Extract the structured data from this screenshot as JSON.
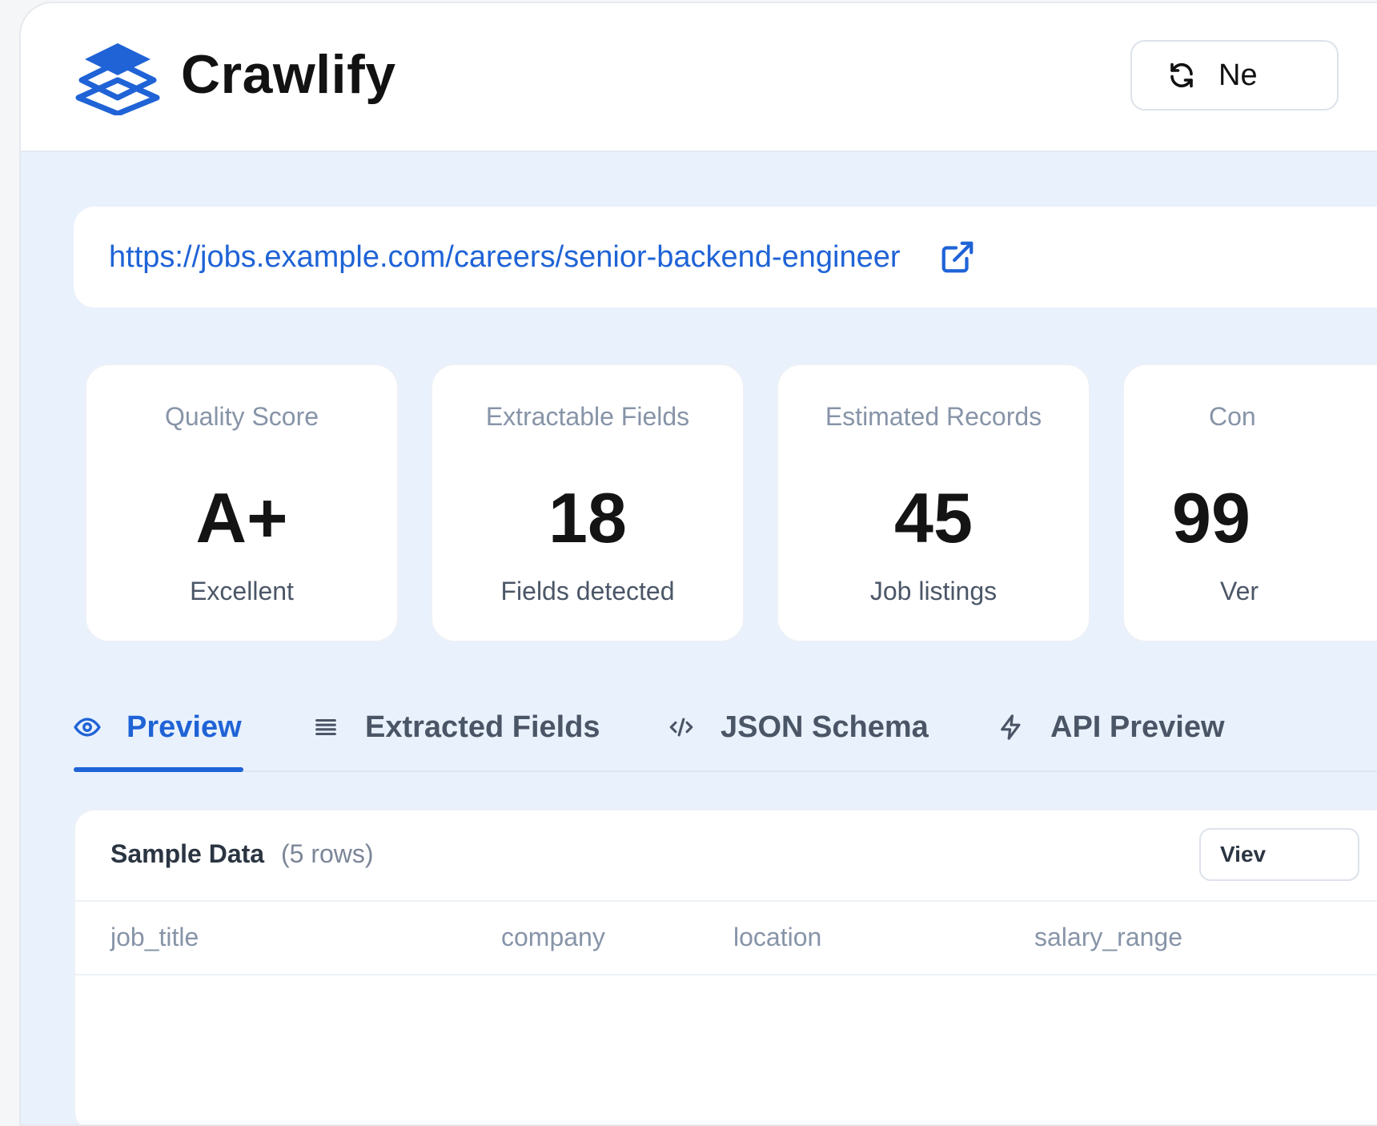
{
  "header": {
    "brand": "Crawlify",
    "new_button_label": "Ne",
    "colors": {
      "accent": "#1f63d6",
      "brand_icon": "#1f63d6"
    }
  },
  "url_bar": {
    "url": "https://jobs.example.com/careers/senior-backend-engineer",
    "icon": "external-link-icon"
  },
  "stats": [
    {
      "label": "Quality Score",
      "value": "A+",
      "sub": "Excellent"
    },
    {
      "label": "Extractable Fields",
      "value": "18",
      "sub": "Fields detected"
    },
    {
      "label": "Estimated Records",
      "value": "45",
      "sub": "Job listings"
    },
    {
      "label": "Con",
      "value": "99",
      "sub": "Ver"
    }
  ],
  "tabs": [
    {
      "label": "Preview",
      "icon": "eye-icon",
      "active": true
    },
    {
      "label": "Extracted Fields",
      "icon": "list-icon",
      "active": false
    },
    {
      "label": "JSON Schema",
      "icon": "code-icon",
      "active": false
    },
    {
      "label": "API Preview",
      "icon": "bolt-icon",
      "active": false
    }
  ],
  "sample": {
    "title": "Sample Data",
    "rows_label": "(5 rows)",
    "view_button_label": "Viev",
    "columns": [
      "job_title",
      "company",
      "location",
      "salary_range"
    ]
  }
}
